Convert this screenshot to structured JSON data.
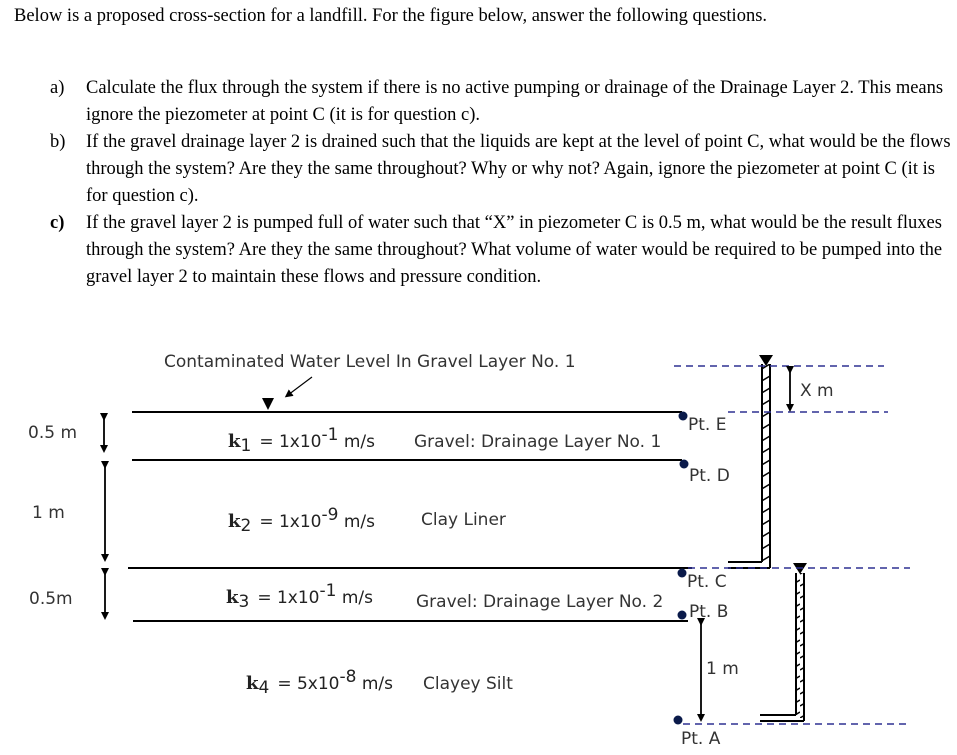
{
  "intro": "Below is a proposed cross-section for a landfill. For the figure below, answer the following questions.",
  "questions": [
    {
      "label": "a)",
      "text": "Calculate the flux through the system if there is no active pumping or drainage of the Drainage Layer 2. This means ignore the piezometer at point C (it is for question c)."
    },
    {
      "label": "b)",
      "text": "If the gravel drainage layer 2 is drained such that the liquids are kept at the level of point C, what would be the flows through the system? Are they the same throughout? Why or why not? Again, ignore the piezometer at point C (it is for question c)."
    },
    {
      "label": "c)",
      "text": "If the gravel layer 2 is pumped full of water such that “X” in piezometer C is 0.5 m, what would be the result fluxes through the system? Are they the same throughout? What volume of water would be required to be pumped into the gravel layer 2 to maintain these flows and pressure condition."
    }
  ],
  "figure": {
    "water_level_label": "Contaminated Water Level In Gravel Layer No. 1",
    "thicknesses": [
      "0.5 m",
      "1 m",
      "0.5m"
    ],
    "layers": [
      {
        "k_sym": "k",
        "k_sub": "1",
        "k_eq": "= 1x10",
        "k_exp": "-1",
        "k_unit": " m/s",
        "name": "Gravel: Drainage Layer No.  1"
      },
      {
        "k_sym": "k",
        "k_sub": "2",
        "k_eq": "= 1x10",
        "k_exp": "-9",
        "k_unit": " m/s",
        "name": "Clay Liner"
      },
      {
        "k_sym": "k",
        "k_sub": "3",
        "k_eq": "= 1x10",
        "k_exp": "-1",
        "k_unit": " m/s",
        "name": "Gravel: Drainage Layer No.  2"
      },
      {
        "k_sym": "k",
        "k_sub": "4",
        "k_eq": "= 5x10",
        "k_exp": "-8",
        "k_unit": " m/s",
        "name": "Clayey Silt"
      }
    ],
    "points": {
      "E": "Pt. E",
      "D": "Pt. D",
      "C": "Pt. C",
      "B": "Pt. B",
      "A": "Pt. A"
    },
    "x_label": "X m",
    "ab_distance": "1 m",
    "colors": {
      "dash": "#2e3192",
      "point": "#0a1a4a",
      "line": "#000000"
    }
  }
}
